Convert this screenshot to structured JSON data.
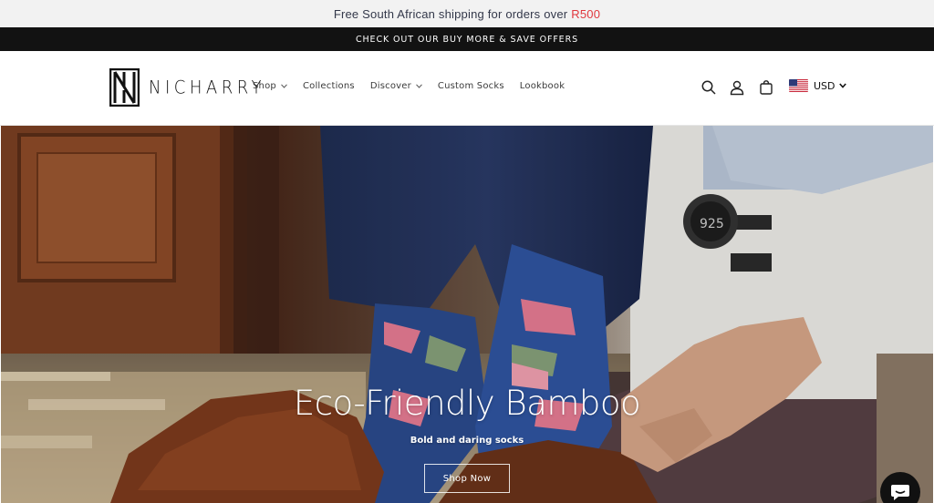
{
  "announcement": {
    "shipping_text": "Free South African shipping for orders over",
    "shipping_amount": "R500",
    "promo_text": "CHECK OUT OUR BUY MORE & SAVE OFFERS"
  },
  "header": {
    "logo_text": "NICHARRY",
    "nav": [
      {
        "label": "Shop",
        "has_dropdown": true
      },
      {
        "label": "Collections",
        "has_dropdown": false
      },
      {
        "label": "Discover",
        "has_dropdown": true
      },
      {
        "label": "Custom Socks",
        "has_dropdown": false
      },
      {
        "label": "Lookbook",
        "has_dropdown": false
      }
    ],
    "icons": [
      "search-icon",
      "account-icon",
      "cart-icon"
    ],
    "currency": "USD"
  },
  "hero": {
    "title": "Eco-Friendly Bamboo",
    "subtitle": "Bold and daring socks",
    "button_label": "Shop Now"
  },
  "colors": {
    "announcement_bg": "#f2f2f2",
    "promo_bar_bg": "#121212",
    "price_accent": "#e0383e",
    "chat_button": "#111111"
  }
}
